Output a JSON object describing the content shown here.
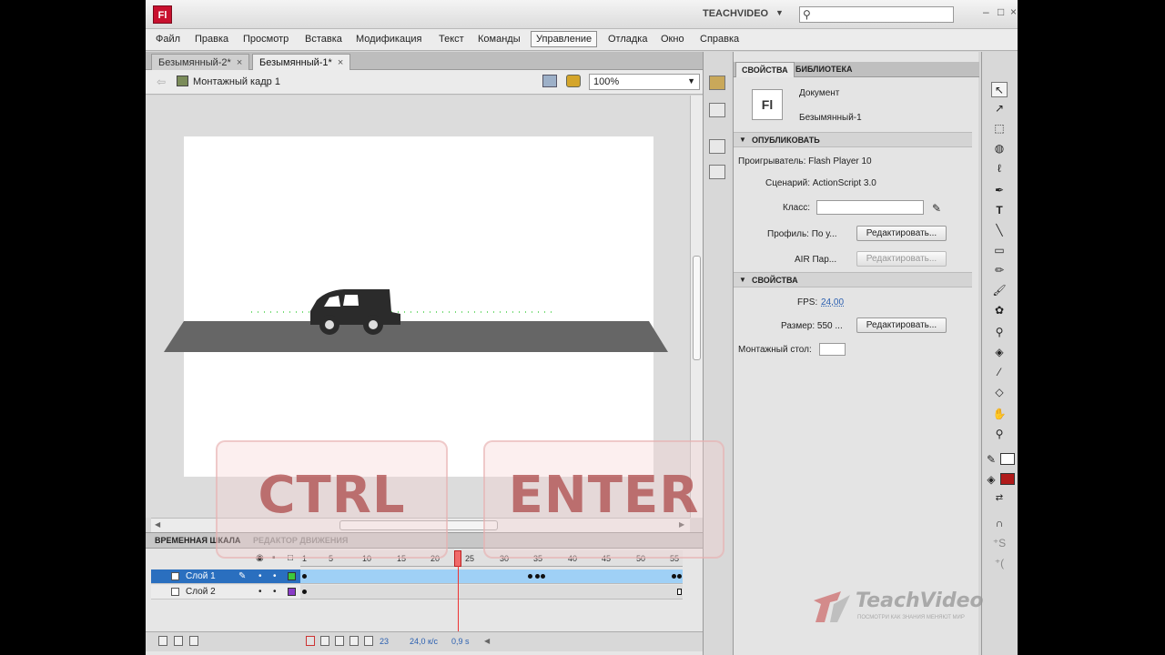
{
  "app": {
    "logo": "Fl",
    "workspace": "TEACHVIDEO"
  },
  "menu": [
    "Файл",
    "Правка",
    "Просмотр",
    "Вставка",
    "Модификация",
    "Текст",
    "Команды",
    "Управление",
    "Отладка",
    "Окно",
    "Справка"
  ],
  "menu_active": "Управление",
  "doc_tabs": [
    {
      "label": "Безымянный-2*",
      "active": false
    },
    {
      "label": "Безымянный-1*",
      "active": true
    }
  ],
  "editbar": {
    "scene": "Монтажный кадр 1",
    "zoom": "100%"
  },
  "timeline": {
    "tabs": [
      "ВРЕМЕННАЯ ШКАЛА",
      "РЕДАКТОР ДВИЖЕНИЯ"
    ],
    "frame_numbers": [
      "1",
      "5",
      "10",
      "15",
      "20",
      "25",
      "30",
      "35",
      "40",
      "45",
      "50",
      "55"
    ],
    "layers": [
      {
        "name": "Слой 1",
        "selected": true,
        "color": "#3cc83c"
      },
      {
        "name": "Слой 2",
        "selected": false,
        "color": "#8a3cc8"
      }
    ],
    "status": {
      "frame": "23",
      "fps": "24,0 к/с",
      "time": "0,9 s"
    }
  },
  "properties": {
    "tabs": [
      "СВОЙСТВА",
      "БИБЛИОТЕКА"
    ],
    "doc_icon": "Fl",
    "doc_type": "Документ",
    "doc_name": "Безымянный-1",
    "publish_section": "ОПУБЛИКОВАТЬ",
    "player": "Проигрыватель: Flash Player 10",
    "script": "Сценарий: ActionScript 3.0",
    "class_label": "Класс:",
    "profile_label": "Профиль: По у...",
    "edit_label": "Редактировать...",
    "air_label": "AIR Пар...",
    "props_section": "СВОЙСТВА",
    "fps_label": "FPS:",
    "fps_value": "24,00",
    "size_label": "Размер: 550 ...",
    "stage_label": "Монтажный стол:"
  },
  "overlay": {
    "key1": "CTRL",
    "key2": "ENTER"
  },
  "watermark": {
    "brand": "TeachVideo",
    "slogan": "ПОСМОТРИ КАК ЗНАНИЯ МЕНЯЮТ МИР"
  },
  "colors": {
    "accent": "#c8102e",
    "selection": "#2a6fbf",
    "playhead": "#e33333"
  }
}
